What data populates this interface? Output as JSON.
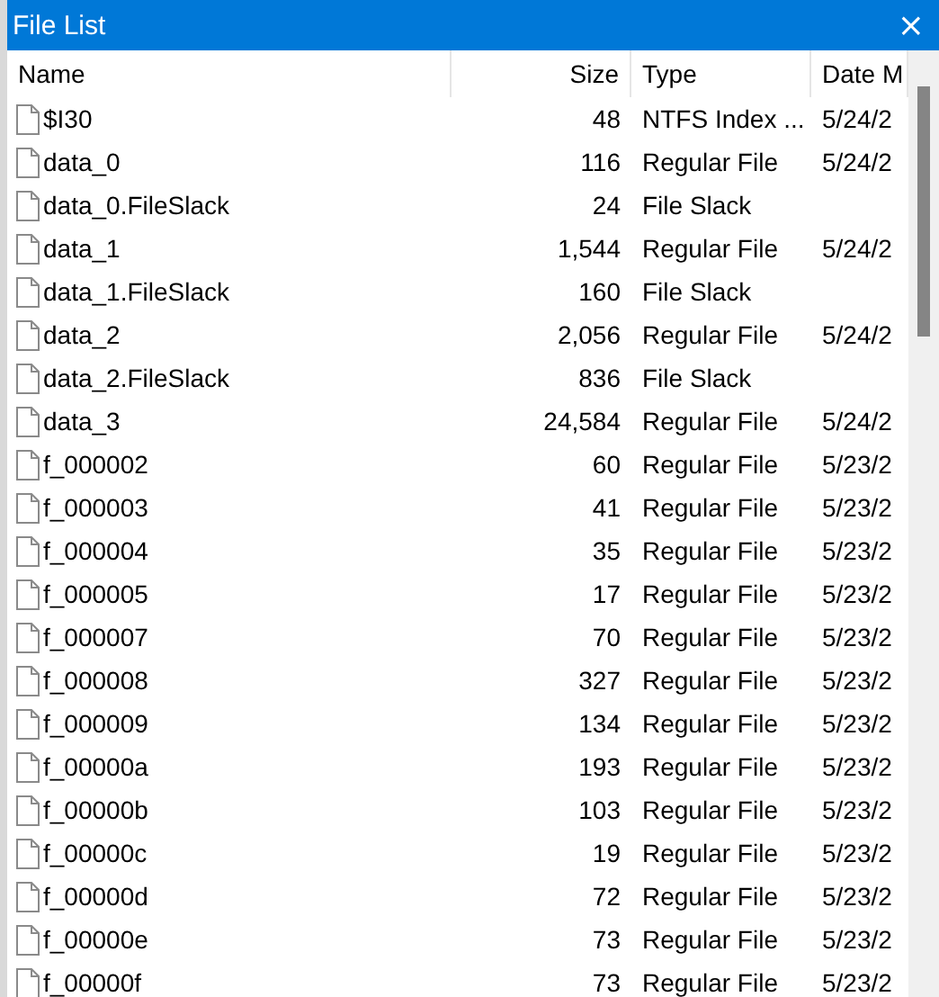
{
  "window": {
    "title": "File List",
    "close": "×"
  },
  "table": {
    "columns": [
      "Name",
      "Size",
      "Type",
      "Date M"
    ],
    "rows": [
      {
        "name": "$I30",
        "size": "48",
        "type": "NTFS Index ...",
        "date": "5/24/2"
      },
      {
        "name": "data_0",
        "size": "116",
        "type": "Regular File",
        "date": "5/24/2"
      },
      {
        "name": "data_0.FileSlack",
        "size": "24",
        "type": "File Slack"
      },
      {
        "name": "data_1",
        "size": "1,544",
        "type": "Regular File",
        "date": "5/24/2"
      },
      {
        "name": "data_1.FileSlack",
        "size": "160",
        "type": "File Slack"
      },
      {
        "name": "data_2",
        "size": "2,056",
        "type": "Regular File",
        "date": "5/24/2"
      },
      {
        "name": "data_2.FileSlack",
        "size": "836",
        "type": "File Slack"
      },
      {
        "name": "data_3",
        "size": "24,584",
        "type": "Regular File",
        "date": "5/24/2"
      },
      {
        "name": "f_000002",
        "size": "60",
        "type": "Regular File",
        "date": "5/23/2"
      },
      {
        "name": "f_000003",
        "size": "41",
        "type": "Regular File",
        "date": "5/23/2"
      },
      {
        "name": "f_000004",
        "size": "35",
        "type": "Regular File",
        "date": "5/23/2"
      },
      {
        "name": "f_000005",
        "size": "17",
        "type": "Regular File",
        "date": "5/23/2"
      },
      {
        "name": "f_000007",
        "size": "70",
        "type": "Regular File",
        "date": "5/23/2"
      },
      {
        "name": "f_000008",
        "size": "327",
        "type": "Regular File",
        "date": "5/23/2"
      },
      {
        "name": "f_000009",
        "size": "134",
        "type": "Regular File",
        "date": "5/23/2"
      },
      {
        "name": "f_00000a",
        "size": "193",
        "type": "Regular File",
        "date": "5/23/2"
      },
      {
        "name": "f_00000b",
        "size": "103",
        "type": "Regular File",
        "date": "5/23/2"
      },
      {
        "name": "f_00000c",
        "size": "19",
        "type": "Regular File",
        "date": "5/23/2"
      },
      {
        "name": "f_00000d",
        "size": "72",
        "type": "Regular File",
        "date": "5/23/2"
      },
      {
        "name": "f_00000e",
        "size": "73",
        "type": "Regular File",
        "date": "5/23/2"
      },
      {
        "name": "f_00000f",
        "size": "73",
        "type": "Regular File",
        "date": "5/23/2"
      }
    ]
  }
}
